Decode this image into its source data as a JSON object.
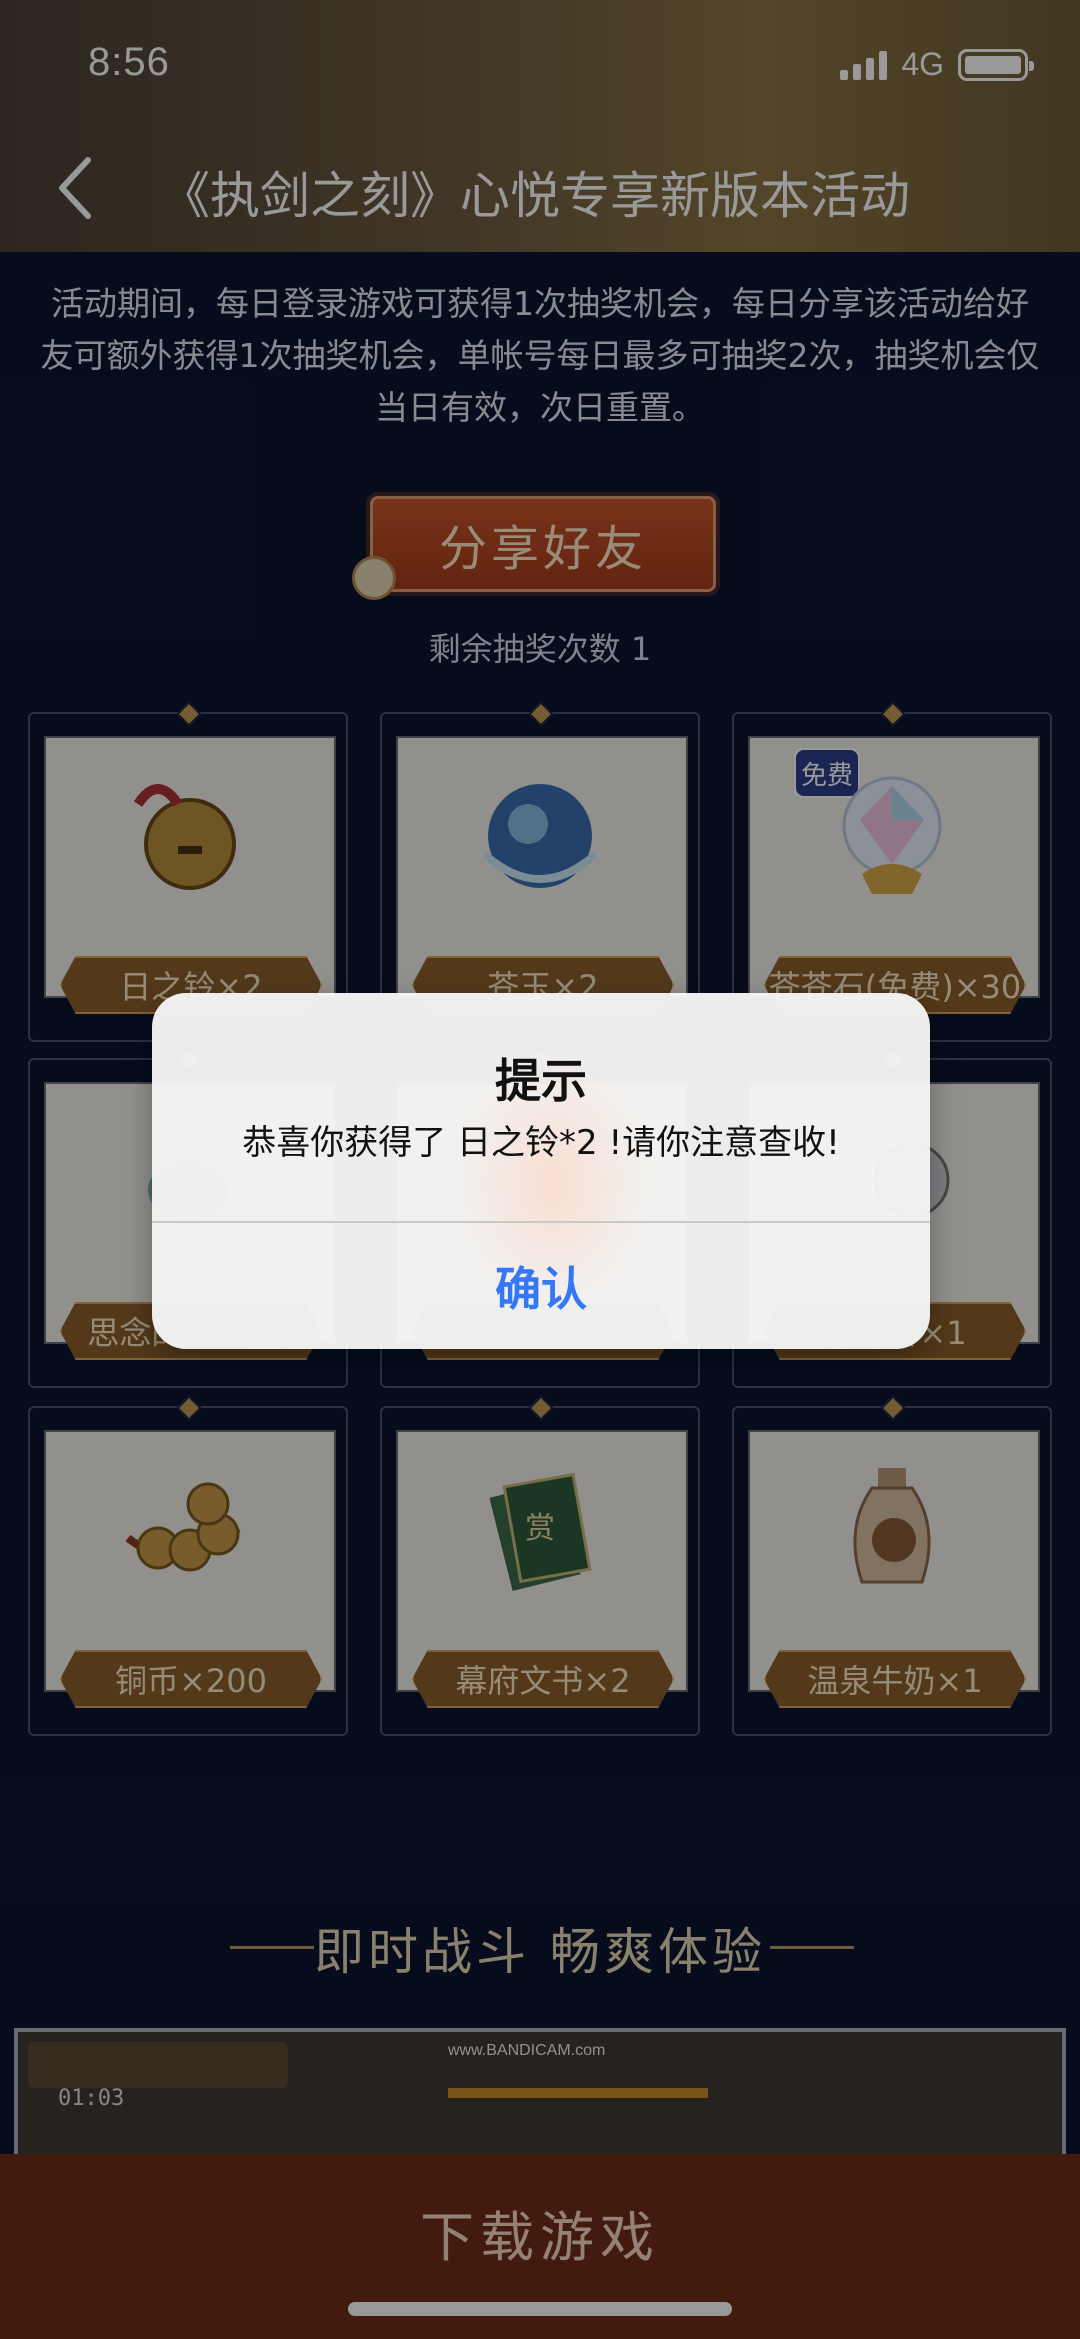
{
  "status_bar": {
    "time": "8:56",
    "network": "4G"
  },
  "nav": {
    "title": "《执剑之刻》心悦专享新版本活动"
  },
  "description": "活动期间，每日登录游戏可获得1次抽奖机会，每日分享该活动给好友可额外获得1次抽奖机会，单帐号每日最多可抽奖2次，抽奖机会仅当日有效，次日重置。",
  "share_button": "分享好友",
  "remaining": "剩余抽奖次数 1",
  "prizes": [
    {
      "label": "日之铃×2",
      "icon": "bell-icon"
    },
    {
      "label": "苍玉×2",
      "icon": "blue-orb-icon"
    },
    {
      "label": "苍苍石(免费)×30",
      "icon": "crystal-icon",
      "badge": "免费"
    },
    {
      "label": "思念的牌石×3",
      "icon": "stone-icon"
    },
    {
      "label": "",
      "icon": "item-icon"
    },
    {
      "label": "月之铃×1",
      "icon": "bell-icon"
    },
    {
      "label": "铜币×200",
      "icon": "coin-icon"
    },
    {
      "label": "幕府文书×2",
      "icon": "document-icon",
      "art_text": "赏"
    },
    {
      "label": "温泉牛奶×1",
      "icon": "milk-bottle-icon"
    }
  ],
  "section_title": "即时战斗 畅爽体验",
  "video": {
    "watermark": "www.BANDICAM.com",
    "time": "01:03"
  },
  "download_button": "下载游戏",
  "alert": {
    "title": "提示",
    "message": "恭喜你获得了 日之铃*2 !请你注意查收!",
    "confirm": "确认"
  },
  "colors": {
    "accent": "#3478f6",
    "background": "#0a1530",
    "download_bar": "#6e2d18"
  }
}
